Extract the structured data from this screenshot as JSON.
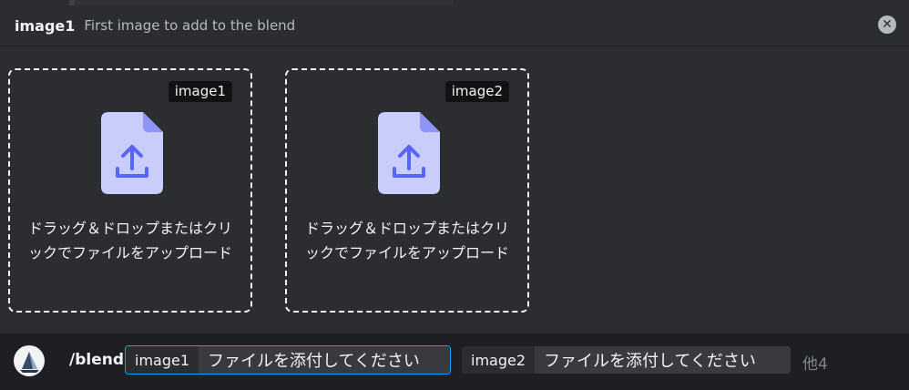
{
  "option": {
    "name": "image1",
    "description": "First image to add to the blend"
  },
  "dropzones": [
    {
      "tag": "image1",
      "text": "ドラッグ＆ドロップまたはクリックでファイルをアップロード"
    },
    {
      "tag": "image2",
      "text": "ドラッグ＆ドロップまたはクリックでファイルをアップロード"
    }
  ],
  "command": {
    "name": "/blend",
    "params": [
      {
        "name": "image1",
        "value": "ファイルを添付してください"
      },
      {
        "name": "image2",
        "value": "ファイルを添付してください"
      }
    ],
    "more": "他4"
  },
  "colors": {
    "accent": "#00a8fc",
    "upload_icon": "#5865f2",
    "file_icon_bg": "#c9cdfb"
  }
}
